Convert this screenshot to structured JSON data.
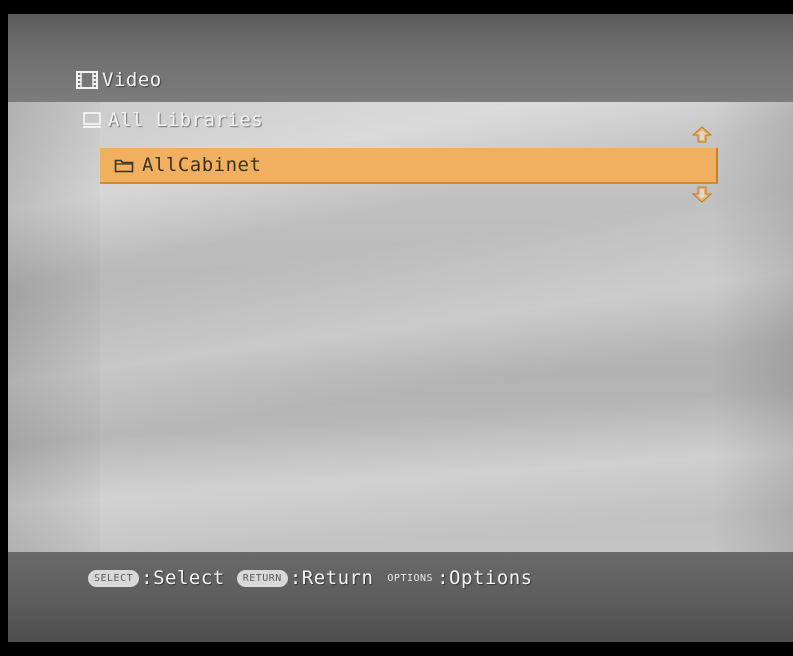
{
  "header": {
    "title": "Video",
    "title_icon": "film-icon"
  },
  "breadcrumb": {
    "label": "All Libraries",
    "icon": "monitor-library-icon"
  },
  "list": {
    "items": [
      {
        "label": "AllCabinet",
        "icon": "folder-icon",
        "selected": true
      }
    ],
    "scroll_up_icon": "scroll-up-arrow-icon",
    "scroll_down_icon": "scroll-down-arrow-icon"
  },
  "footer": {
    "hints": [
      {
        "key": "SELECT",
        "label": ":Select"
      },
      {
        "key": "RETURN",
        "label": ":Return"
      },
      {
        "key": "OPTIONS",
        "label": ":Options"
      }
    ]
  },
  "colors": {
    "highlight": "#f0b060",
    "header_bg": "#6e6e6e",
    "body_bg": "#bdbdbd",
    "footer_bg": "#5b5b5b",
    "arrow": "#f0b060"
  }
}
